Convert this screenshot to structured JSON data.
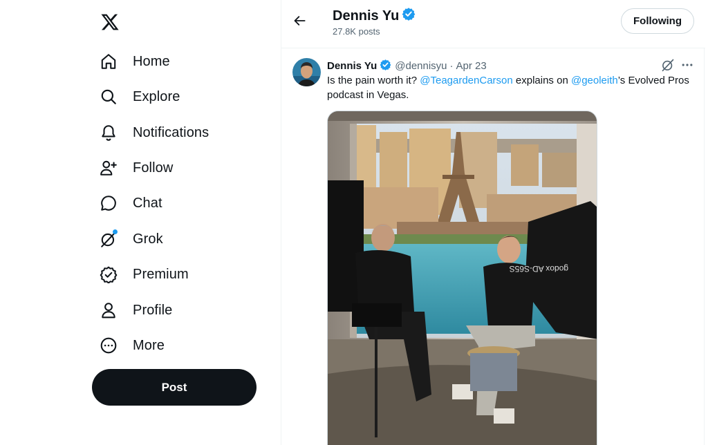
{
  "nav": {
    "logo": "X",
    "items": [
      {
        "label": "Home",
        "icon": "home-icon"
      },
      {
        "label": "Explore",
        "icon": "search-icon"
      },
      {
        "label": "Notifications",
        "icon": "bell-icon"
      },
      {
        "label": "Follow",
        "icon": "add-person-icon"
      },
      {
        "label": "Chat",
        "icon": "chat-bubble-icon"
      },
      {
        "label": "Grok",
        "icon": "grok-icon"
      },
      {
        "label": "Premium",
        "icon": "verified-badge-icon"
      },
      {
        "label": "Profile",
        "icon": "person-icon"
      },
      {
        "label": "More",
        "icon": "more-circle-icon"
      }
    ],
    "post_label": "Post"
  },
  "header": {
    "name": "Dennis Yu",
    "posts": "27.8K posts",
    "follow_label": "Following"
  },
  "tweet": {
    "name": "Dennis Yu",
    "handle": "@dennisyu",
    "separator": "·",
    "date": "Apr 23",
    "text_1": "Is the pain worth it? ",
    "mention_1": "@TeagardenCarson",
    "text_2": " explains on ",
    "mention_2": "@geoleith",
    "text_3": "’s Evolved Pros podcast in Vegas.",
    "media_caption": "godox AD-S65S"
  },
  "colors": {
    "accent": "#1d9bf0",
    "text": "#0f1419",
    "muted": "#536471",
    "post_button": "#0f1419"
  }
}
